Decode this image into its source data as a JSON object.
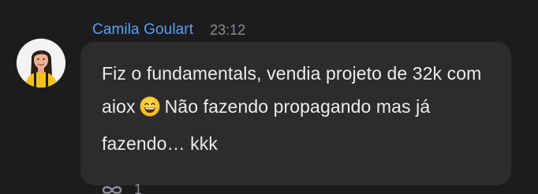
{
  "message": {
    "sender": "Camila Goulart",
    "time": "23:12",
    "text_before_emoji": "Fiz o fundamentals, vendia projeto de 32k com aiox",
    "emoji": "grinning-face-with-smiling-eyes",
    "text_after_emoji": "Não fazendo propagando mas já fazendo… kkk",
    "avatar": "avatar"
  },
  "reactions": {
    "icon": "infinity-icon",
    "count": "1"
  },
  "colors": {
    "background": "#1c1c1e",
    "bubble": "#2c2c2e",
    "sender": "#5b9ff3",
    "text": "#ececee",
    "muted": "#8e8e93"
  }
}
